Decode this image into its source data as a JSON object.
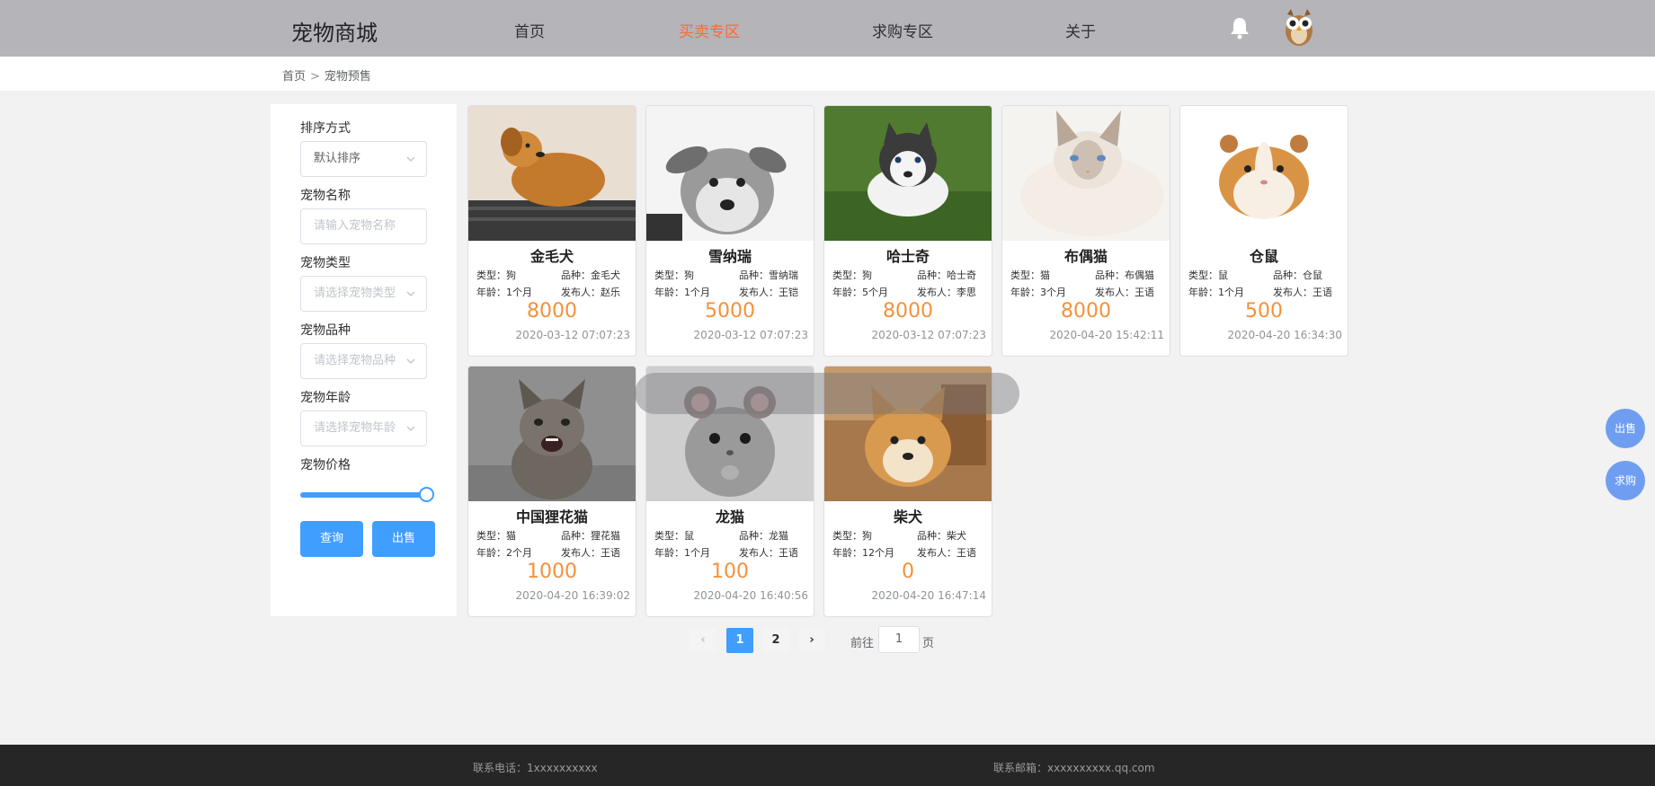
{
  "header": {
    "logo": "宠物商城",
    "nav": [
      {
        "label": "首页"
      },
      {
        "label": "买卖专区"
      },
      {
        "label": "求购专区"
      },
      {
        "label": "关于"
      }
    ],
    "active_nav": "买卖专区",
    "accent_color": "#f56c3a"
  },
  "breadcrumb": [
    "首页",
    "宠物预售"
  ],
  "filters": {
    "sort_label": "排序方式",
    "sort_value": "默认排序",
    "name_label": "宠物名称",
    "name_placeholder": "请输入宠物名称",
    "type_label": "宠物类型",
    "type_placeholder": "请选择宠物类型",
    "breed_label": "宠物品种",
    "breed_placeholder": "请选择宠物品种",
    "age_label": "宠物年龄",
    "age_placeholder": "请选择宠物年龄",
    "price_label": "宠物价格",
    "price_slider_level": 1.0,
    "query_button": "查询",
    "sell_button": "出售"
  },
  "products": [
    {
      "name": "金毛犬",
      "type": "类型：狗",
      "breed": "品种：金毛犬",
      "age": "年龄：1个月",
      "publisher": "发布人：赵乐",
      "price": "8000",
      "time": "2020-03-12 07:07:23",
      "image": "golden-retriever"
    },
    {
      "name": "雪纳瑞",
      "type": "类型：狗",
      "breed": "品种：雪纳瑞",
      "age": "年龄：1个月",
      "publisher": "发布人：王铠",
      "price": "5000",
      "time": "2020-03-12 07:07:23",
      "image": "schnauzer"
    },
    {
      "name": "哈士奇",
      "type": "类型：狗",
      "breed": "品种：哈士奇",
      "age": "年龄：5个月",
      "publisher": "发布人：李思",
      "price": "8000",
      "time": "2020-03-12 07:07:23",
      "image": "husky"
    },
    {
      "name": "布偶猫",
      "type": "类型：猫",
      "breed": "品种：布偶猫",
      "age": "年龄：3个月",
      "publisher": "发布人：王语",
      "price": "8000",
      "time": "2020-04-20 15:42:11",
      "image": "ragdoll-cat"
    },
    {
      "name": "仓鼠",
      "type": "类型：鼠",
      "breed": "品种：仓鼠",
      "age": "年龄：1个月",
      "publisher": "发布人：王语",
      "price": "500",
      "time": "2020-04-20 16:34:30",
      "image": "hamster"
    },
    {
      "name": "中国狸花猫",
      "type": "类型：猫",
      "breed": "品种：狸花猫",
      "age": "年龄：2个月",
      "publisher": "发布人：王语",
      "price": "1000",
      "time": "2020-04-20 16:39:02",
      "image": "tabby-kitten"
    },
    {
      "name": "龙猫",
      "type": "类型：鼠",
      "breed": "品种：龙猫",
      "age": "年龄：1个月",
      "publisher": "发布人：王语",
      "price": "100",
      "time": "2020-04-20 16:40:56",
      "image": "chinchilla"
    },
    {
      "name": "柴犬",
      "type": "类型：狗",
      "breed": "品种：柴犬",
      "age": "年龄：12个月",
      "publisher": "发布人：王语",
      "price": "0",
      "time": "2020-04-20 16:47:14",
      "image": "shiba-inu"
    }
  ],
  "pagination": {
    "prev_icon": "chevron-left-icon",
    "pages": [
      "1",
      "2"
    ],
    "current": "1",
    "next_icon": "chevron-right-icon",
    "goto_prefix": "前往",
    "goto_value": "1",
    "goto_suffix": "页"
  },
  "floating": {
    "sell": "出售",
    "buy": "求购"
  },
  "footer": {
    "phone": "联系电话：1xxxxxxxxxx",
    "email": "联系邮箱：xxxxxxxxxx.qq.com"
  },
  "colors": {
    "primary": "#409eff",
    "price": "#f5913a",
    "header_bg": "#b5b4b9",
    "footer_bg": "#262626"
  }
}
